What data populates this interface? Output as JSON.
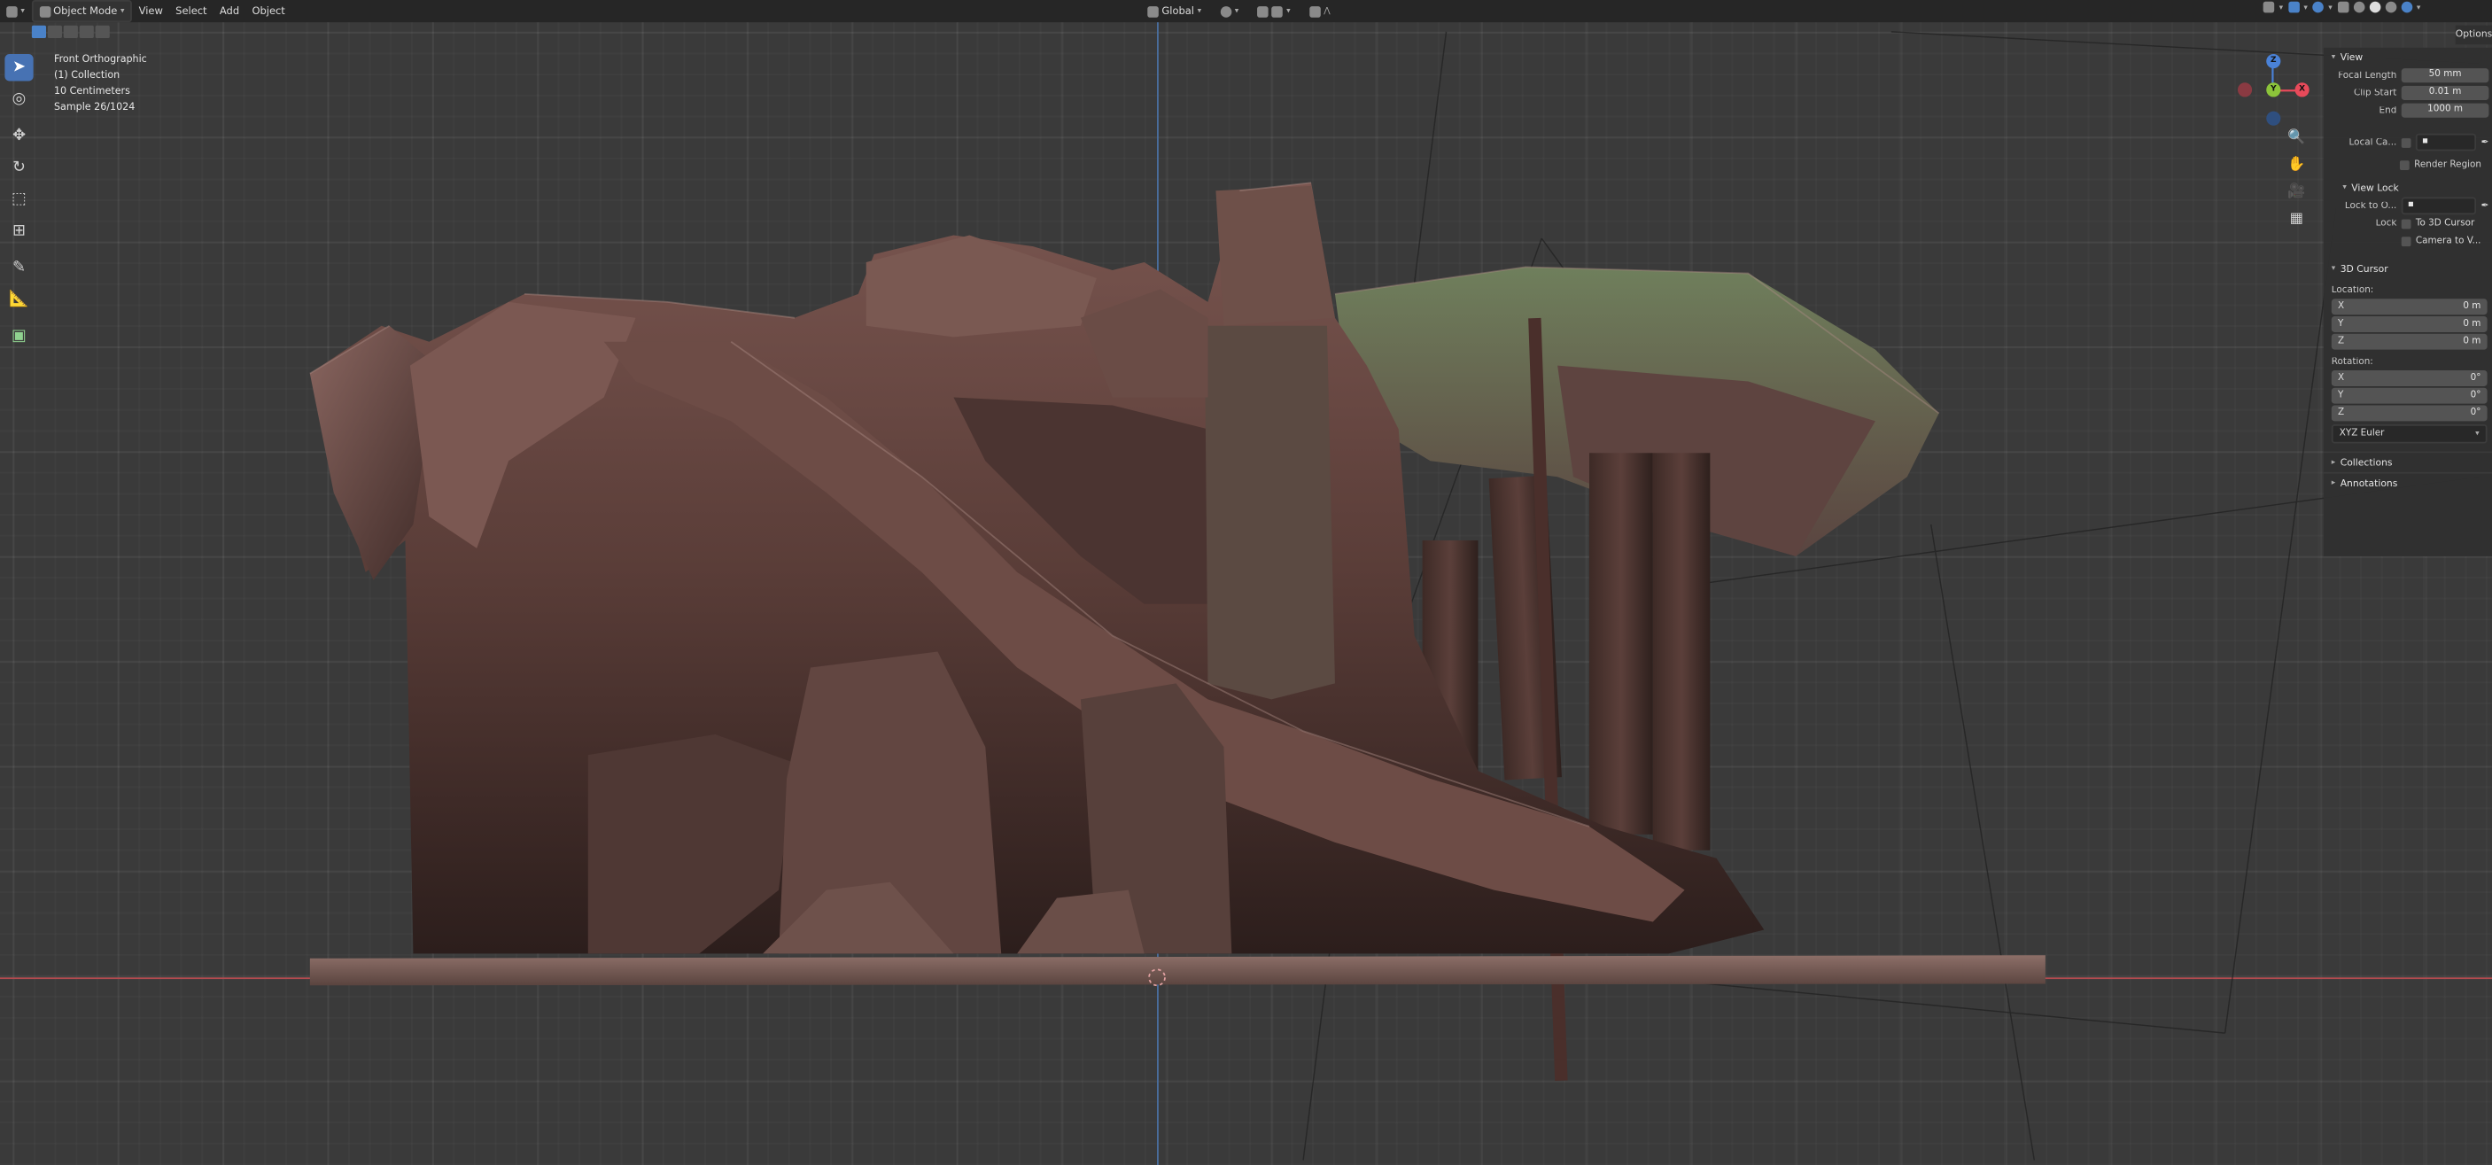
{
  "header": {
    "mode_label": "Object Mode",
    "menu": [
      "View",
      "Select",
      "Add",
      "Object"
    ],
    "transform_orientation": "Global"
  },
  "overlay": {
    "view_name": "Front Orthographic",
    "collection": "(1) Collection",
    "scale": "10 Centimeters",
    "samples": "Sample 26/1024"
  },
  "gizmo": {
    "z": "Z",
    "y": "Y",
    "x": "X"
  },
  "npanel": {
    "tab_label": "Options",
    "view": {
      "title": "View",
      "focal_length_label": "Focal Length",
      "focal_length": "50 mm",
      "clip_start_label": "Clip Start",
      "clip_start": "0.01 m",
      "end_label": "End",
      "clip_end": "1000 m",
      "local_camera_label": "Local Ca...",
      "render_region_label": "Render Region"
    },
    "view_lock": {
      "title": "View Lock",
      "lock_to_object_label": "Lock to O...",
      "lock_label": "Lock",
      "to_3d_cursor_label": "To 3D Cursor",
      "camera_to_view_label": "Camera to V..."
    },
    "cursor": {
      "title": "3D Cursor",
      "location_label": "Location:",
      "location": [
        {
          "axis": "X",
          "value": "0 m"
        },
        {
          "axis": "Y",
          "value": "0 m"
        },
        {
          "axis": "Z",
          "value": "0 m"
        }
      ],
      "rotation_label": "Rotation:",
      "rotation": [
        {
          "axis": "X",
          "value": "0°"
        },
        {
          "axis": "Y",
          "value": "0°"
        },
        {
          "axis": "Z",
          "value": "0°"
        }
      ],
      "rotation_mode": "XYZ Euler"
    },
    "collections_title": "Collections",
    "annotations_title": "Annotations"
  },
  "colors": {
    "active_tool": "#4772b3",
    "x_axis": "#b24a4f",
    "z_axis": "#4a6f9f",
    "gizmo_x": "#e84a5a",
    "gizmo_y": "#8cc43a",
    "gizmo_z": "#4a82d8"
  }
}
